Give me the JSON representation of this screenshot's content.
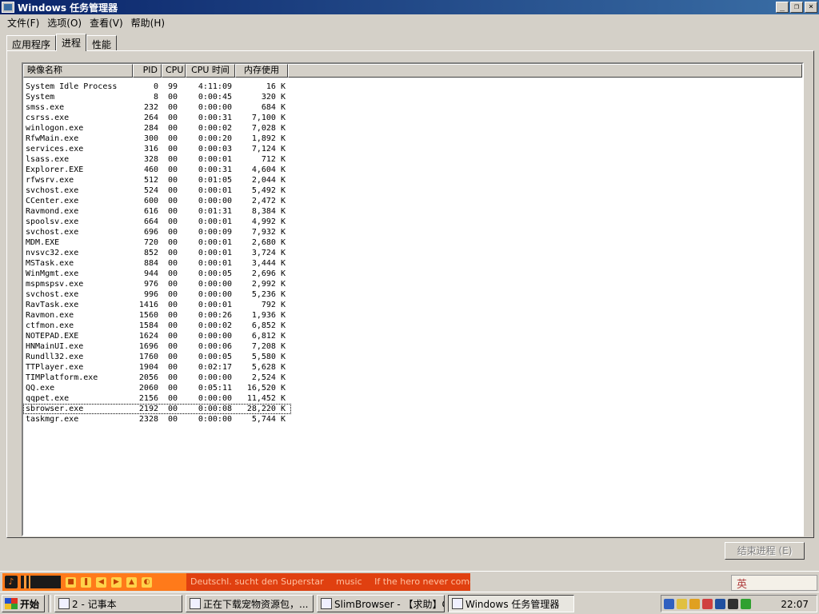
{
  "window": {
    "title": "Windows 任务管理器",
    "buttons": {
      "minimize": "_",
      "maximize": "❐",
      "close": "×"
    }
  },
  "menu": [
    "文件(F)",
    "选项(O)",
    "查看(V)",
    "帮助(H)"
  ],
  "tabs": [
    {
      "label": "应用程序",
      "active": false
    },
    {
      "label": "进程",
      "active": true
    },
    {
      "label": "性能",
      "active": false
    }
  ],
  "columns": {
    "name": "映像名称",
    "pid": "PID",
    "cpu": "CPU",
    "time": "CPU 时间",
    "mem": "内存使用"
  },
  "processes": [
    {
      "name": "System Idle Process",
      "pid": "0",
      "cpu": "99",
      "time": "4:11:09",
      "mem": "16 K"
    },
    {
      "name": "System",
      "pid": "8",
      "cpu": "00",
      "time": "0:00:45",
      "mem": "320 K"
    },
    {
      "name": "smss.exe",
      "pid": "232",
      "cpu": "00",
      "time": "0:00:00",
      "mem": "684 K"
    },
    {
      "name": "csrss.exe",
      "pid": "264",
      "cpu": "00",
      "time": "0:00:31",
      "mem": "7,100 K"
    },
    {
      "name": "winlogon.exe",
      "pid": "284",
      "cpu": "00",
      "time": "0:00:02",
      "mem": "7,028 K"
    },
    {
      "name": "RfwMain.exe",
      "pid": "300",
      "cpu": "00",
      "time": "0:00:20",
      "mem": "1,892 K"
    },
    {
      "name": "services.exe",
      "pid": "316",
      "cpu": "00",
      "time": "0:00:03",
      "mem": "7,124 K"
    },
    {
      "name": "lsass.exe",
      "pid": "328",
      "cpu": "00",
      "time": "0:00:01",
      "mem": "712 K"
    },
    {
      "name": "Explorer.EXE",
      "pid": "460",
      "cpu": "00",
      "time": "0:00:31",
      "mem": "4,604 K"
    },
    {
      "name": "rfwsrv.exe",
      "pid": "512",
      "cpu": "00",
      "time": "0:01:05",
      "mem": "2,044 K"
    },
    {
      "name": "svchost.exe",
      "pid": "524",
      "cpu": "00",
      "time": "0:00:01",
      "mem": "5,492 K"
    },
    {
      "name": "CCenter.exe",
      "pid": "600",
      "cpu": "00",
      "time": "0:00:00",
      "mem": "2,472 K"
    },
    {
      "name": "Ravmond.exe",
      "pid": "616",
      "cpu": "00",
      "time": "0:01:31",
      "mem": "8,384 K"
    },
    {
      "name": "spoolsv.exe",
      "pid": "664",
      "cpu": "00",
      "time": "0:00:01",
      "mem": "4,992 K"
    },
    {
      "name": "svchost.exe",
      "pid": "696",
      "cpu": "00",
      "time": "0:00:09",
      "mem": "7,932 K"
    },
    {
      "name": "MDM.EXE",
      "pid": "720",
      "cpu": "00",
      "time": "0:00:01",
      "mem": "2,680 K"
    },
    {
      "name": "nvsvc32.exe",
      "pid": "852",
      "cpu": "00",
      "time": "0:00:01",
      "mem": "3,724 K"
    },
    {
      "name": "MSTask.exe",
      "pid": "884",
      "cpu": "00",
      "time": "0:00:01",
      "mem": "3,444 K"
    },
    {
      "name": "WinMgmt.exe",
      "pid": "944",
      "cpu": "00",
      "time": "0:00:05",
      "mem": "2,696 K"
    },
    {
      "name": "mspmspsv.exe",
      "pid": "976",
      "cpu": "00",
      "time": "0:00:00",
      "mem": "2,992 K"
    },
    {
      "name": "svchost.exe",
      "pid": "996",
      "cpu": "00",
      "time": "0:00:00",
      "mem": "5,236 K"
    },
    {
      "name": "RavTask.exe",
      "pid": "1416",
      "cpu": "00",
      "time": "0:00:01",
      "mem": "792 K"
    },
    {
      "name": "Ravmon.exe",
      "pid": "1560",
      "cpu": "00",
      "time": "0:00:26",
      "mem": "1,936 K"
    },
    {
      "name": "ctfmon.exe",
      "pid": "1584",
      "cpu": "00",
      "time": "0:00:02",
      "mem": "6,852 K"
    },
    {
      "name": "NOTEPAD.EXE",
      "pid": "1624",
      "cpu": "00",
      "time": "0:00:00",
      "mem": "6,812 K"
    },
    {
      "name": "HNMainUI.exe",
      "pid": "1696",
      "cpu": "00",
      "time": "0:00:06",
      "mem": "7,208 K"
    },
    {
      "name": "Rundll32.exe",
      "pid": "1760",
      "cpu": "00",
      "time": "0:00:05",
      "mem": "5,580 K"
    },
    {
      "name": "TTPlayer.exe",
      "pid": "1904",
      "cpu": "00",
      "time": "0:02:17",
      "mem": "5,628 K"
    },
    {
      "name": "TIMPlatform.exe",
      "pid": "2056",
      "cpu": "00",
      "time": "0:00:00",
      "mem": "2,524 K"
    },
    {
      "name": "QQ.exe",
      "pid": "2060",
      "cpu": "00",
      "time": "0:05:11",
      "mem": "16,520 K"
    },
    {
      "name": "qqpet.exe",
      "pid": "2156",
      "cpu": "00",
      "time": "0:00:00",
      "mem": "11,452 K"
    },
    {
      "name": "sbrowser.exe",
      "pid": "2192",
      "cpu": "00",
      "time": "0:00:08",
      "mem": "28,220 K"
    },
    {
      "name": "taskmgr.exe",
      "pid": "2328",
      "cpu": "00",
      "time": "0:00:00",
      "mem": "5,744 K"
    }
  ],
  "selected_row": 31,
  "end_process_label": "结束进程 (E)",
  "media": {
    "ticker": [
      "Deutschl. sucht den Superstar",
      "music",
      "If the hero never comes to yo..."
    ]
  },
  "ime": {
    "label": "英"
  },
  "taskbar": {
    "start_label": "开始",
    "tasks": [
      {
        "label": "2 - 记事本",
        "active": false
      },
      {
        "label": "正在下载宠物资源包，...",
        "active": false
      },
      {
        "label": "SlimBrowser - 【求助】C...",
        "active": false
      },
      {
        "label": "Windows 任务管理器",
        "active": true
      }
    ],
    "clock": "22:07"
  },
  "colors": {
    "title_start": "#0a246a",
    "title_end": "#3a6ea5",
    "face": "#d4d0c8",
    "ticker_bg": "#e04010",
    "player_bg": "#ff7a1a"
  }
}
